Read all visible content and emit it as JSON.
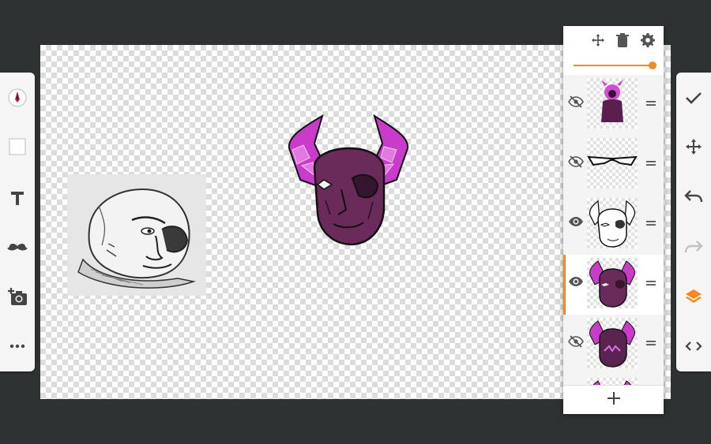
{
  "colors": {
    "background": "#2f3233",
    "accent": "#f08a24",
    "icon": "#444444",
    "disabled_icon": "#c2c2c2"
  },
  "left_toolbar": {
    "tools": [
      {
        "name": "brush-color",
        "icon": "pen-nib-icon"
      },
      {
        "name": "fill-color",
        "icon": "white-square-icon"
      },
      {
        "name": "text",
        "icon": "text-T-icon"
      },
      {
        "name": "stickers",
        "icon": "mustache-icon"
      },
      {
        "name": "add-photo",
        "icon": "camera-plus-icon"
      },
      {
        "name": "more",
        "icon": "more-dots-icon"
      }
    ]
  },
  "right_toolbar": {
    "tools": [
      {
        "name": "done",
        "icon": "check-icon",
        "enabled": true
      },
      {
        "name": "move",
        "icon": "move-arrows-icon",
        "enabled": true
      },
      {
        "name": "undo",
        "icon": "undo-icon",
        "enabled": true
      },
      {
        "name": "redo",
        "icon": "redo-icon",
        "enabled": false
      },
      {
        "name": "layers",
        "icon": "layers-icon",
        "enabled": true,
        "active": true
      },
      {
        "name": "code",
        "icon": "code-brackets-icon",
        "enabled": true
      }
    ]
  },
  "layers_panel": {
    "header_icons": [
      "move-arrows-icon",
      "trash-icon",
      "gear-icon"
    ],
    "opacity": 1.0,
    "layers": [
      {
        "visible": false,
        "selected": false,
        "content": "magenta-figure"
      },
      {
        "visible": false,
        "selected": false,
        "content": "eye-mask-outline"
      },
      {
        "visible": true,
        "selected": false,
        "content": "demon-head-lineart"
      },
      {
        "visible": true,
        "selected": true,
        "content": "demon-head-colored"
      },
      {
        "visible": false,
        "selected": false,
        "content": "demon-head-zigzag"
      },
      {
        "visible": false,
        "selected": false,
        "content": "demon-horns-partial"
      }
    ],
    "add_icon": "plus-icon"
  },
  "canvas": {
    "objects": [
      "pencil-sketch-face",
      "purple-demon-head"
    ]
  }
}
